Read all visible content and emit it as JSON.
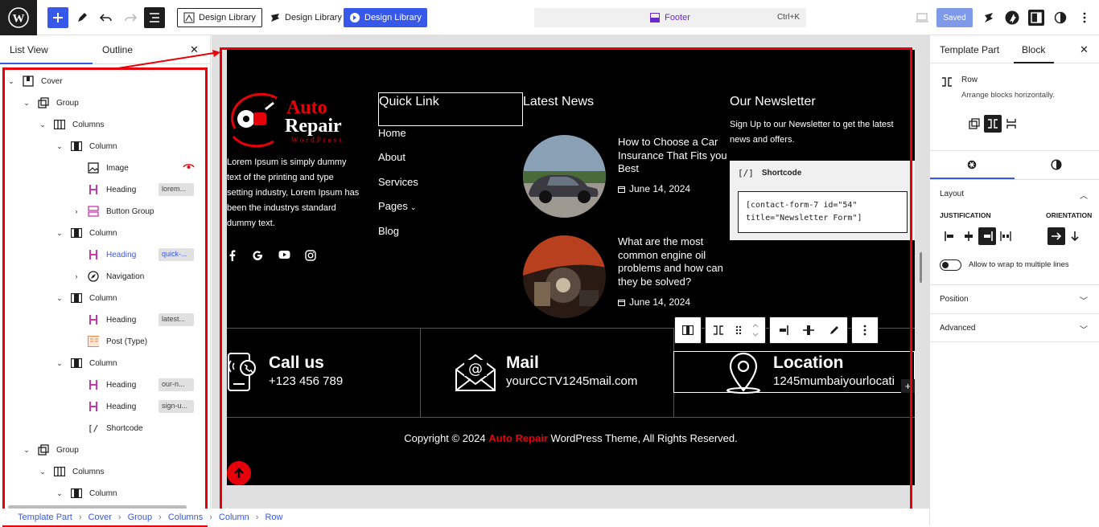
{
  "topbar": {
    "design_library_1": "Design Library",
    "design_library_2": "Design Library",
    "design_library_3": "Design Library",
    "command_title": "Footer",
    "command_shortcut": "Ctrl+K",
    "saved_label": "Saved"
  },
  "left_panel": {
    "tabs": [
      "List View",
      "Outline"
    ],
    "tree": [
      {
        "label": "Cover",
        "icon": "cover-icon"
      },
      {
        "label": "Group",
        "icon": "group-icon"
      },
      {
        "label": "Columns",
        "icon": "columns-icon"
      },
      {
        "label": "Column",
        "icon": "column-icon"
      },
      {
        "label": "Image",
        "icon": "image-icon"
      },
      {
        "label": "Heading",
        "icon": "heading-icon",
        "tag": "lorem..."
      },
      {
        "label": "Button Group",
        "icon": "buttons-icon"
      },
      {
        "label": "Column",
        "icon": "column-icon"
      },
      {
        "label": "Heading",
        "icon": "heading-icon",
        "tag": "quick-..."
      },
      {
        "label": "Navigation",
        "icon": "navigation-icon"
      },
      {
        "label": "Column",
        "icon": "column-icon"
      },
      {
        "label": "Heading",
        "icon": "heading-icon",
        "tag": "latest..."
      },
      {
        "label": "Post (Type)",
        "icon": "post-type-icon"
      },
      {
        "label": "Column",
        "icon": "column-icon"
      },
      {
        "label": "Heading",
        "icon": "heading-icon",
        "tag": "our-n..."
      },
      {
        "label": "Heading",
        "icon": "heading-icon",
        "tag": "sign-u..."
      },
      {
        "label": "Shortcode",
        "icon": "shortcode-icon"
      },
      {
        "label": "Group",
        "icon": "group-icon"
      },
      {
        "label": "Columns",
        "icon": "columns-icon"
      },
      {
        "label": "Column",
        "icon": "column-icon"
      }
    ]
  },
  "breadcrumb": [
    "Template Part",
    "Cover",
    "Group",
    "Columns",
    "Column",
    "Row"
  ],
  "footer": {
    "logo_line1": "Auto",
    "logo_line2": "Repair",
    "logo_tagline": "WordPress",
    "about_text": "Lorem Ipsum is simply dummy text of the printing and type setting industry, Lorem Ipsum has been the industrys standard dummy text.",
    "quick_link_title": "Quick Link",
    "nav": [
      "Home",
      "About",
      "Services",
      "Pages",
      "Blog"
    ],
    "latest_news_title": "Latest News",
    "news": [
      {
        "title": "How to Choose a Car Insurance That Fits you Best",
        "date": "June 14, 2024"
      },
      {
        "title": "What are the most common engine oil problems and how can they be solved?",
        "date": "June 14, 2024"
      }
    ],
    "newsletter_title": "Our Newsletter",
    "newsletter_text": "Sign Up to our Newsletter to get the latest news and offers.",
    "shortcode_label": "Shortcode",
    "shortcode_value": "[contact-form-7 id=\"54\" title=\"Newsletter Form\"]",
    "contacts": [
      {
        "title": "Call us",
        "value": "+123 456 789"
      },
      {
        "title": "Mail",
        "value": "yourCCTV1245mail.com"
      },
      {
        "title": "Location",
        "value": "1245mumbaiyourlocati"
      }
    ],
    "copyright_pre": "Copyright © 2024 ",
    "copyright_brand": "Auto Repair",
    "copyright_post": " WordPress Theme, All Rights Reserved."
  },
  "right_panel": {
    "tabs": [
      "Template Part",
      "Block"
    ],
    "block_name": "Row",
    "block_desc": "Arrange blocks horizontally.",
    "layout_title": "Layout",
    "justification_label": "JUSTIFICATION",
    "orientation_label": "ORIENTATION",
    "wrap_label": "Allow to wrap to multiple lines",
    "position_title": "Position",
    "advanced_title": "Advanced"
  },
  "colors": {
    "accent": "#3858e9",
    "brand_red": "#e5000a",
    "dark": "#1e1e1e"
  }
}
